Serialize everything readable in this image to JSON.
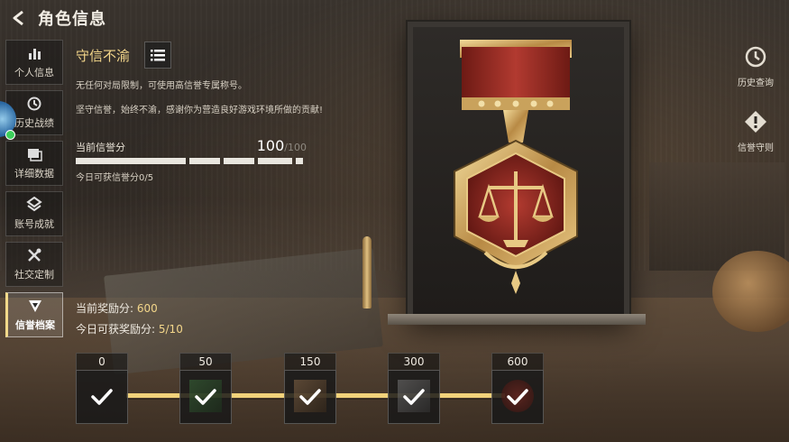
{
  "header": {
    "title": "角色信息"
  },
  "sidebar": {
    "items": [
      {
        "label": "个人信息",
        "icon": "bar-chart-icon",
        "active": false
      },
      {
        "label": "历史战绩",
        "icon": "history-icon",
        "active": false
      },
      {
        "label": "详细数据",
        "icon": "data-icon",
        "active": false
      },
      {
        "label": "账号成就",
        "icon": "achievement-icon",
        "active": false
      },
      {
        "label": "社交定制",
        "icon": "tools-icon",
        "active": false
      },
      {
        "label": "信誉档案",
        "icon": "reputation-icon",
        "active": true
      }
    ]
  },
  "panel": {
    "title": "守信不渝",
    "desc1": "无任何对局限制，可使用高信誉专属称号。",
    "desc2": "坚守信誉，始终不渝，感谢你为营造良好游戏环境所做的贡献!",
    "credit_label": "当前信誉分",
    "credit_value": "100",
    "credit_max": "/100",
    "credit_fraction": 1.0,
    "today_credit": "今日可获信誉分0/5"
  },
  "rewards": {
    "current_label": "当前奖励分:",
    "current_value": "600",
    "today_label": "今日可获奖励分:",
    "today_value": "5/10"
  },
  "milestones": [
    {
      "value": "0",
      "claimed": true
    },
    {
      "value": "50",
      "claimed": true
    },
    {
      "value": "150",
      "claimed": true
    },
    {
      "value": "300",
      "claimed": true
    },
    {
      "value": "600",
      "claimed": true
    }
  ],
  "right": {
    "history_label": "历史查询",
    "rules_label": "信誉守则"
  },
  "colors": {
    "gold": "#f3d68a",
    "track": "#f1d27a",
    "medal_red": "#9a2a22"
  }
}
